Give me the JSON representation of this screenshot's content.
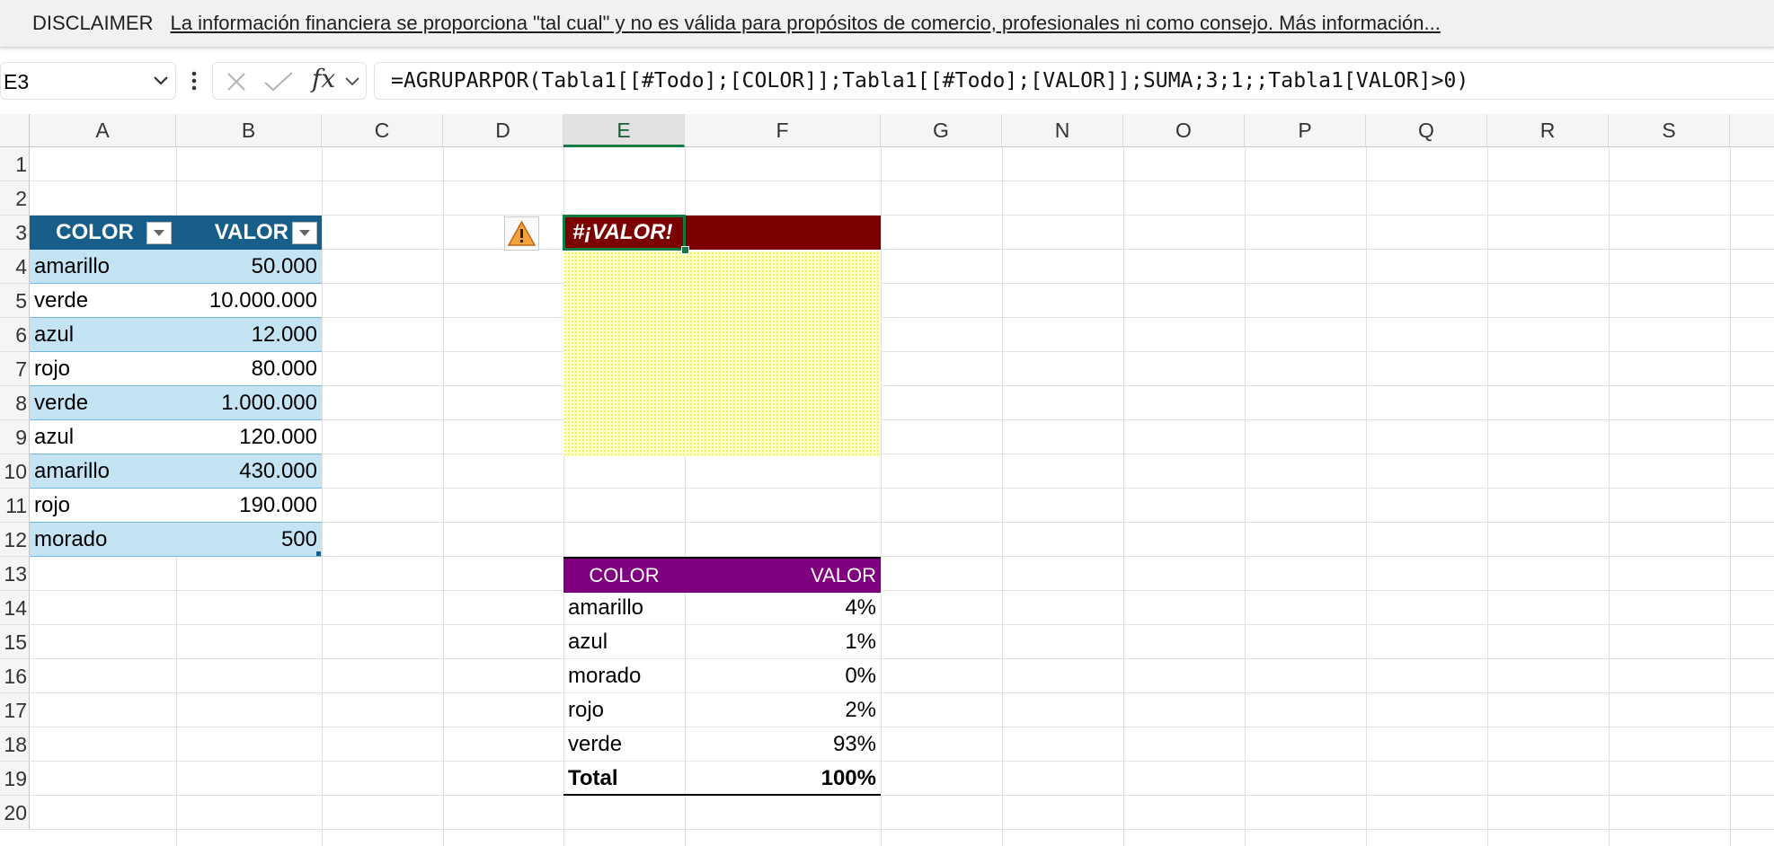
{
  "disclaimer": {
    "title": "DISCLAIMER",
    "text": "La información financiera se proporciona \"tal cual\" y no es válida para propósitos de comercio, profesionales ni como consejo. Más información..."
  },
  "formula_bar": {
    "name_box": "E3",
    "fx_label": "fx",
    "formula": "=AGRUPARPOR(Tabla1[[#Todo];[COLOR]];Tabla1[[#Todo];[VALOR]];SUMA;3;1;;Tabla1[VALOR]>0)"
  },
  "columns": [
    "A",
    "B",
    "C",
    "D",
    "E",
    "F",
    "G",
    "N",
    "O",
    "P",
    "Q",
    "R",
    "S"
  ],
  "selected_column": "E",
  "rows": [
    "1",
    "2",
    "3",
    "4",
    "5",
    "6",
    "7",
    "8",
    "9",
    "10",
    "11",
    "12",
    "13",
    "14",
    "15",
    "16",
    "17",
    "18",
    "19",
    "20"
  ],
  "table1": {
    "headers": [
      "COLOR",
      "VALOR"
    ],
    "rows": [
      [
        "amarillo",
        "50.000"
      ],
      [
        "verde",
        "10.000.000"
      ],
      [
        "azul",
        "12.000"
      ],
      [
        "rojo",
        "80.000"
      ],
      [
        "verde",
        "1.000.000"
      ],
      [
        "azul",
        "120.000"
      ],
      [
        "amarillo",
        "430.000"
      ],
      [
        "rojo",
        "190.000"
      ],
      [
        "morado",
        "500"
      ]
    ],
    "header_color": "#185e8a",
    "band_color": "#c4e4f4"
  },
  "error_cell": {
    "value": "#¡VALOR!",
    "color": "#7b0000"
  },
  "spill_area_color": "#ffffc8",
  "table2": {
    "headers": [
      "COLOR",
      "VALOR"
    ],
    "rows": [
      [
        "amarillo",
        "4%"
      ],
      [
        "azul",
        "1%"
      ],
      [
        "morado",
        "0%"
      ],
      [
        "rojo",
        "2%"
      ],
      [
        "verde",
        "93%"
      ]
    ],
    "total": [
      "Total",
      "100%"
    ],
    "header_color": "#7e007e"
  }
}
